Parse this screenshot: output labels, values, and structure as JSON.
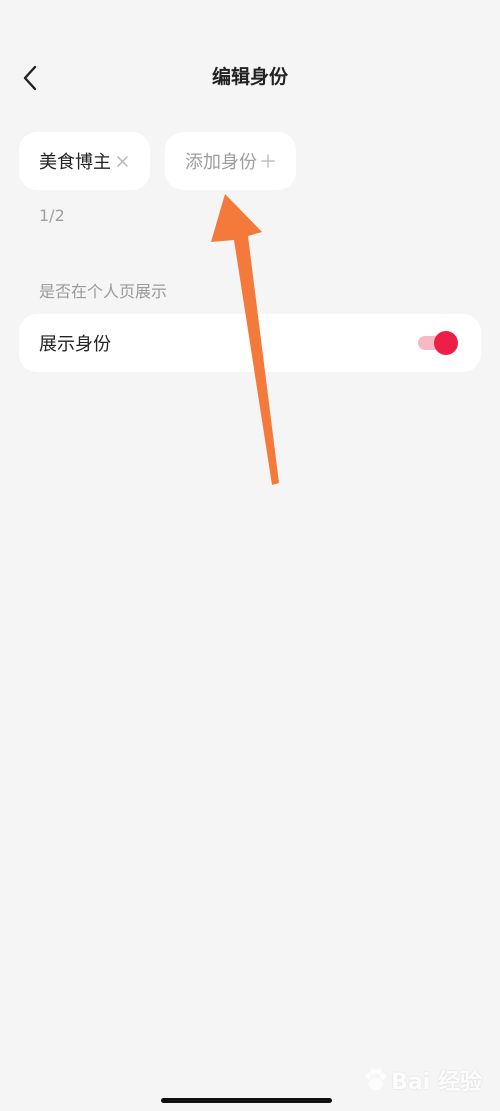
{
  "header": {
    "title": "编辑身份",
    "back_icon": "chevron-left-icon"
  },
  "tags": {
    "identity_label": "美食博主",
    "identity_remove_icon": "close-icon",
    "add_label": "添加身份",
    "add_icon": "plus-icon"
  },
  "count": "1/2",
  "section": {
    "label": "是否在个人页展示"
  },
  "setting": {
    "label": "展示身份",
    "toggle_on": true
  },
  "watermark": {
    "text": "Bai 经验"
  },
  "colors": {
    "background": "#f5f5f5",
    "card": "#ffffff",
    "accent": "#ee1f47",
    "annotation_arrow": "#f47a3c"
  }
}
